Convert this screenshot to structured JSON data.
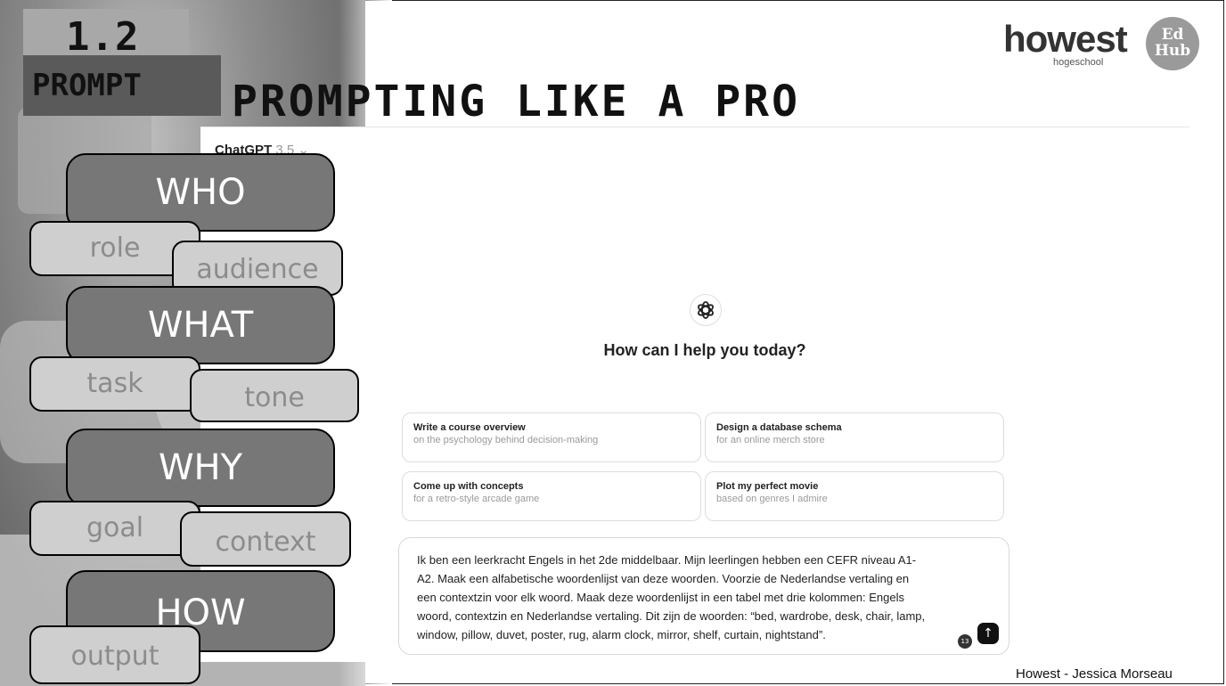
{
  "section": {
    "number": "1.2",
    "label": "PROMPT"
  },
  "slide_title": "PROMPTING LIKE A PRO",
  "logos": {
    "howest_word": "howest",
    "howest_sub": "hogeschool",
    "edhub_top": "Ed",
    "edhub_bottom": "Hub"
  },
  "chat": {
    "model_name": "ChatGPT",
    "model_version": "3.5",
    "greeting": "How can I help you today?",
    "suggestions": [
      {
        "title": "Write a course overview",
        "subtitle": "on the psychology behind decision-making"
      },
      {
        "title": "Design a database schema",
        "subtitle": "for an online merch store"
      },
      {
        "title": "Come up with concepts",
        "subtitle": "for a retro-style arcade game"
      },
      {
        "title": "Plot my perfect movie",
        "subtitle": "based on genres I admire"
      }
    ],
    "prompt_lines": [
      "Ik ben een leerkracht Engels in het 2de middelbaar. Mijn leerlingen hebben een CEFR niveau A1-",
      "A2. Maak een alfabetische woordenlijst van deze woorden. Voorzie de Nederlandse vertaling en",
      "een contextzin voor elk woord. Maak deze woordenlijst in een tabel met drie kolommen: Engels",
      "woord, contextzin en Nederlandse vertaling. Dit zijn de woorden: “bed, wardrobe, desk, chair, lamp,",
      "window, pillow, duvet, poster, rug, alarm clock, mirror, shelf, curtain, nightstand”."
    ],
    "char_badge": "13",
    "send_icon": "arrow-up-icon"
  },
  "framework": {
    "who": "WHO",
    "role": "role",
    "audience": "audience",
    "what": "WHAT",
    "task": "task",
    "tone": "tone",
    "why": "WHY",
    "goal": "goal",
    "context": "context",
    "how": "HOW",
    "output": "output"
  },
  "footer": "Howest - Jessica Morseau"
}
